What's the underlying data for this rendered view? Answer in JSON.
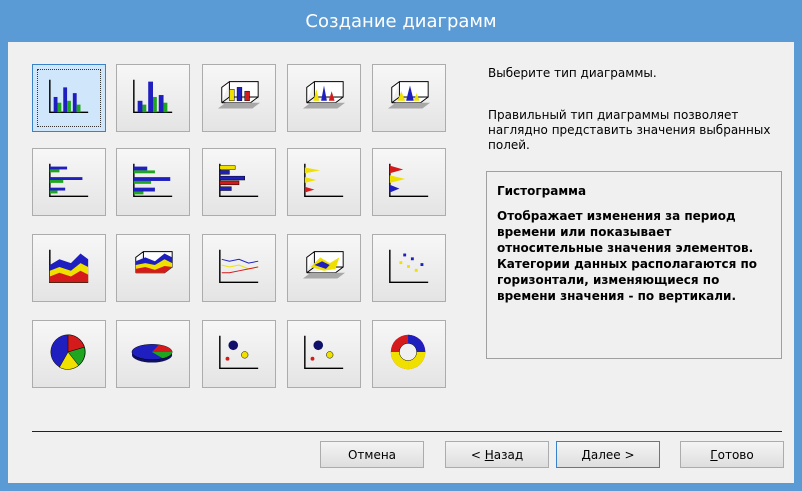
{
  "window": {
    "title": "Создание диаграмм"
  },
  "chart_types": [
    {
      "icon": "column-chart-icon",
      "selected": true
    },
    {
      "icon": "stacked-column-chart-icon"
    },
    {
      "icon": "3d-column-chart-icon"
    },
    {
      "icon": "3d-cone-chart-icon"
    },
    {
      "icon": "3d-pyramid-chart-icon"
    },
    {
      "icon": "bar-chart-icon"
    },
    {
      "icon": "stacked-bar-chart-icon"
    },
    {
      "icon": "3d-bar-chart-icon"
    },
    {
      "icon": "cone-bar-chart-icon"
    },
    {
      "icon": "pyramid-bar-chart-icon"
    },
    {
      "icon": "area-chart-icon"
    },
    {
      "icon": "3d-area-chart-icon"
    },
    {
      "icon": "line-chart-icon"
    },
    {
      "icon": "3d-surface-chart-icon"
    },
    {
      "icon": "scatter-chart-icon"
    },
    {
      "icon": "pie-chart-icon"
    },
    {
      "icon": "3d-pie-chart-icon"
    },
    {
      "icon": "bubble-chart-icon"
    },
    {
      "icon": "bubble-3d-chart-icon"
    },
    {
      "icon": "doughnut-chart-icon"
    }
  ],
  "instructions": {
    "prompt": "Выберите тип диаграммы.",
    "hint": "Правильный тип диаграммы позволяет наглядно представить значения выбранных полей."
  },
  "description": {
    "title": "Гистограмма",
    "text": "Отображает изменения за период времени или показывает относительные значения элементов. Категории данных располагаются по горизонтали, изменяющиеся по времени значения - по вертикали."
  },
  "buttons": {
    "cancel": "Отмена",
    "back_prefix": "< ",
    "back_accel": "Н",
    "back_rest": "азад",
    "next_accel": "Д",
    "next_rest": "алее >",
    "finish_accel": "Г",
    "finish_rest": "отово"
  },
  "colors": {
    "title_bar": "#5b9bd5",
    "series_blue": "#1f1fbf",
    "series_green": "#1fa51f",
    "series_yellow": "#f0e000",
    "series_red": "#d41a1a"
  }
}
